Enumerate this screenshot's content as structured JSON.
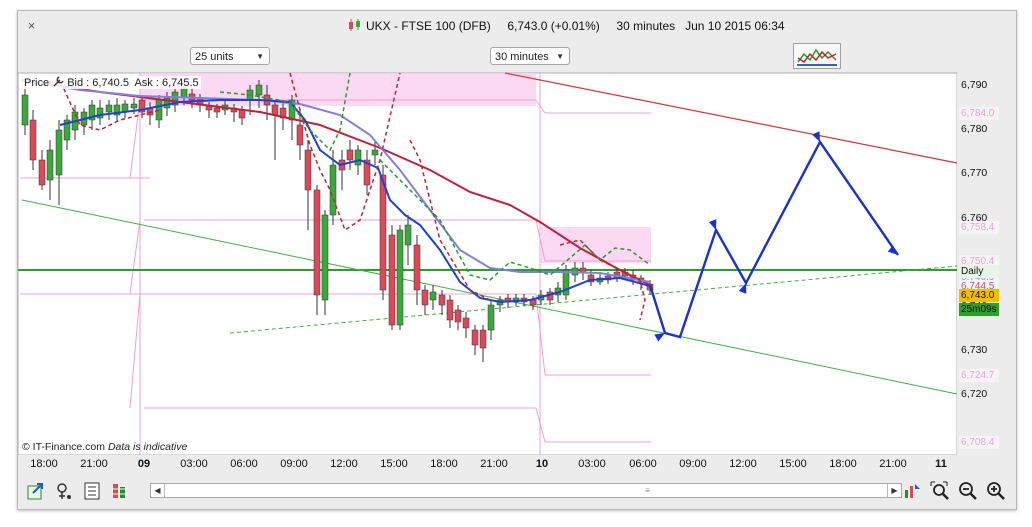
{
  "window": {
    "close_glyph": "×",
    "title": "UKX - FTSE 100 (DFB)     6,743.0 (+0.01%)     30 minutes   Jun 10 2015 06:34"
  },
  "controls": {
    "units_dropdown": "25 units",
    "interval_dropdown": "30 minutes",
    "indicator_icon": "indicators-icon"
  },
  "chart": {
    "price_label": "Price",
    "bid_ask": "Bid : 6,740.5  Ask : 6,745.5",
    "copyright": "© IT-Finance.com",
    "disclaimer": "Data is indicative",
    "y_axis": [
      "6,790",
      "6,780",
      "6,770",
      "6,760",
      "6,750",
      "6,740",
      "6,730",
      "6,720"
    ],
    "y_tags": [
      {
        "text": "6,784.0",
        "color": "#f0a0d8"
      },
      {
        "text": "6,758.4",
        "color": "#f0a0d8"
      },
      {
        "text": "6,750.4",
        "color": "#f0a0d8"
      },
      {
        "text": "6,746.9",
        "color": "#9090e0"
      },
      {
        "text": "6,744.5",
        "color": "#d05070"
      },
      {
        "text": "6,724.7",
        "color": "#f0a0d8"
      },
      {
        "text": "6,708.4",
        "color": "#f0a0d8"
      }
    ],
    "daily_tag": "Daily",
    "last_price_tag": "6,743.0",
    "countdown_tag": "25m09s",
    "x_axis": [
      {
        "text": "18:00",
        "bold": false
      },
      {
        "text": "21:00",
        "bold": false
      },
      {
        "text": "09",
        "bold": true
      },
      {
        "text": "03:00",
        "bold": false
      },
      {
        "text": "06:00",
        "bold": false
      },
      {
        "text": "09:00",
        "bold": false
      },
      {
        "text": "12:00",
        "bold": false
      },
      {
        "text": "15:00",
        "bold": false
      },
      {
        "text": "18:00",
        "bold": false
      },
      {
        "text": "21:00",
        "bold": false
      },
      {
        "text": "10",
        "bold": true
      },
      {
        "text": "03:00",
        "bold": false
      },
      {
        "text": "06:00",
        "bold": false
      },
      {
        "text": "09:00",
        "bold": false
      },
      {
        "text": "12:00",
        "bold": false
      },
      {
        "text": "15:00",
        "bold": false
      },
      {
        "text": "18:00",
        "bold": false
      },
      {
        "text": "21:00",
        "bold": false
      },
      {
        "text": "11",
        "bold": true
      }
    ],
    "colors": {
      "up_candle": "#3aa83a",
      "down_candle": "#d94a5a",
      "ma_fast": "#2040d0",
      "ma_mid": "#8080e0",
      "ma_slow": "#c0203a",
      "daily_line": "#2aa02a",
      "projection": "#1a30d0",
      "pivot": "#f0a0d8"
    }
  },
  "toolbar": {
    "icons": [
      "export-icon",
      "tools-icon",
      "calculator-icon",
      "bars-icon",
      "alert-icon",
      "zoom-fit-icon",
      "zoom-out-icon",
      "zoom-in-icon"
    ]
  }
}
